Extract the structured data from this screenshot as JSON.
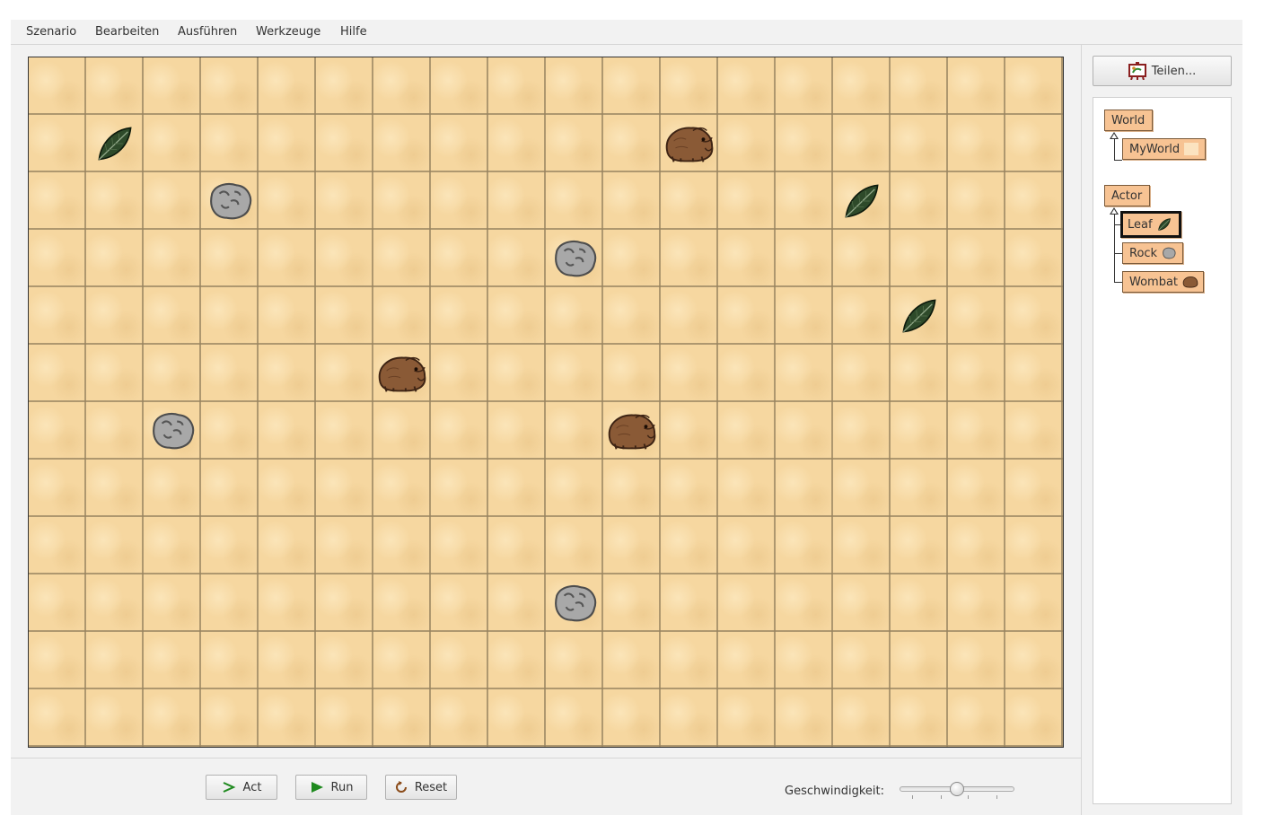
{
  "menu": {
    "items": [
      "Szenario",
      "Bearbeiten",
      "Ausführen",
      "Werkzeuge",
      "Hilfe"
    ]
  },
  "world": {
    "grid_columns": 18,
    "grid_rows": 12,
    "background": "sand",
    "actors": [
      {
        "type": "leaf",
        "col": 1,
        "row": 1
      },
      {
        "type": "wombat",
        "col": 11,
        "row": 1
      },
      {
        "type": "rock",
        "col": 3,
        "row": 2
      },
      {
        "type": "leaf",
        "col": 14,
        "row": 2
      },
      {
        "type": "rock",
        "col": 9,
        "row": 3
      },
      {
        "type": "leaf",
        "col": 15,
        "row": 4
      },
      {
        "type": "wombat",
        "col": 6,
        "row": 5
      },
      {
        "type": "rock",
        "col": 2,
        "row": 6
      },
      {
        "type": "wombat",
        "col": 10,
        "row": 6
      },
      {
        "type": "rock",
        "col": 9,
        "row": 9
      }
    ]
  },
  "controls": {
    "act_label": "Act",
    "run_label": "Run",
    "reset_label": "Reset",
    "speed_label": "Geschwindigkeit:",
    "speed_value": 0.5
  },
  "share": {
    "label": "Teilen..."
  },
  "classes": {
    "world_root": "World",
    "world_sub": "MyWorld",
    "actor_root": "Actor",
    "actor_subs": [
      "Leaf",
      "Rock",
      "Wombat"
    ],
    "selected": "Leaf"
  },
  "colors": {
    "class_box": "#f7c393",
    "world_sand": "#f6d7a0",
    "run_green": "#1f8a1f"
  }
}
